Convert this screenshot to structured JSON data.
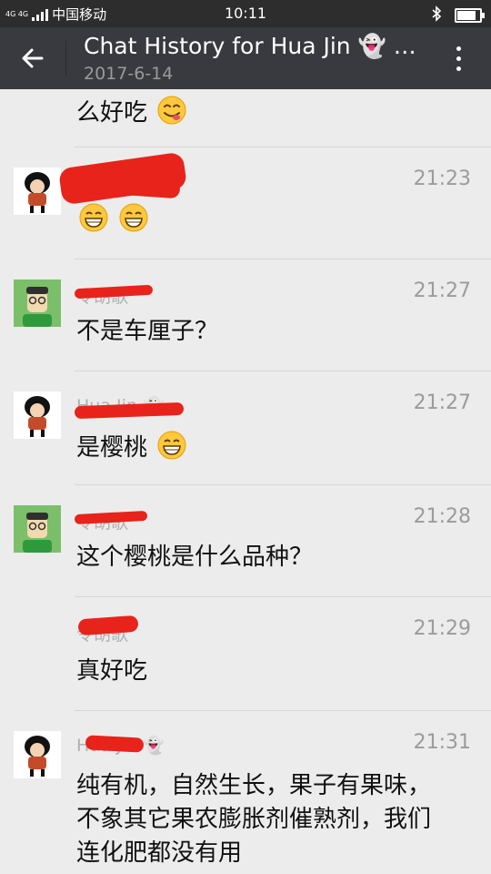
{
  "status_bar": {
    "network": "4G 4G",
    "carrier": "中国移动",
    "time": "10:11",
    "battery_level": 0.75
  },
  "header": {
    "title": "Chat History for Hua Jin 👻 an...",
    "date": "2017-6-14"
  },
  "messages": [
    {
      "text": "么好吃"
    },
    {
      "sender": "",
      "time": "21:23",
      "text": ""
    },
    {
      "sender": "令胡歌",
      "time": "21:27",
      "text": "不是车厘子？"
    },
    {
      "sender": "Hua Jin 👻",
      "time": "21:27",
      "text": "是樱桃"
    },
    {
      "sender": "令胡歌",
      "time": "21:28",
      "text": "这个樱桃是什么品种？"
    },
    {
      "sender": "令胡歌",
      "time": "21:29",
      "text": "真好吃"
    },
    {
      "sender": "Hua Jin 👻",
      "time": "21:31",
      "text": "纯有机，自然生长，果子有果味，不象其它果农膨胀剂催熟剂，我们连化肥都没有用"
    }
  ],
  "icons": {
    "back": "back-arrow-icon",
    "more": "more-vertical-icon",
    "bluetooth": "bluetooth-icon",
    "battery": "battery-icon",
    "emoji_yum": "yum-emoji-icon",
    "emoji_grin": "grin-emoji-icon"
  },
  "colors": {
    "status_bar": "#2d2d2d",
    "app_bar": "#393a3f",
    "background": "#ececec",
    "redaction": "#e8231b"
  }
}
